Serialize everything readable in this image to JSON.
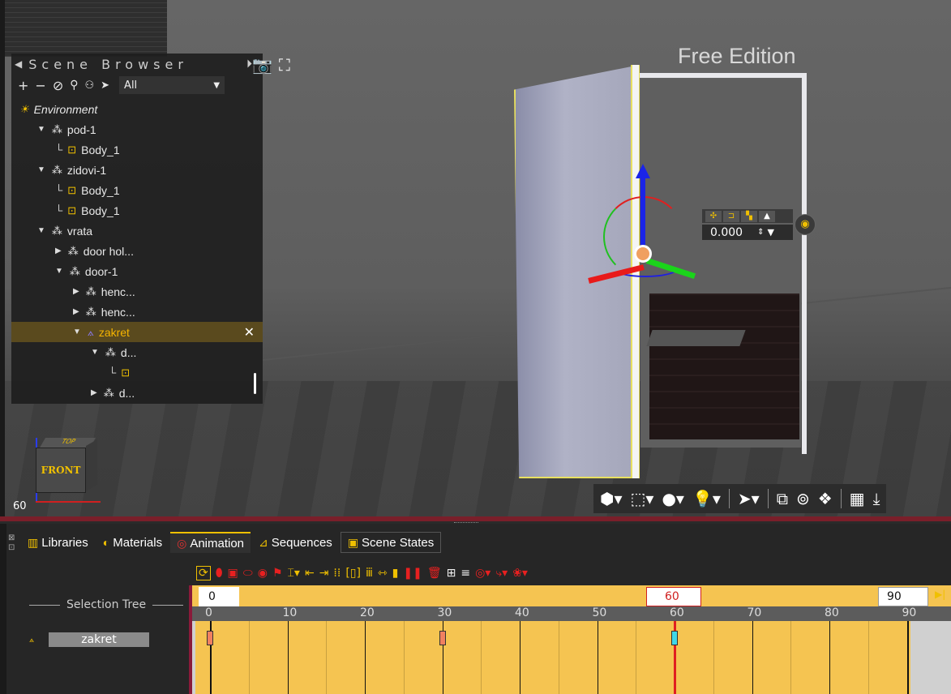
{
  "viewport": {
    "watermark": "Free Edition",
    "fps": "60",
    "viewcube_face": "FRONT",
    "viewcube_top": "TOP",
    "axis_z": "z",
    "axis_x": "x"
  },
  "scene_browser": {
    "title": "Scene Browser",
    "filter_value": "All",
    "tree": [
      {
        "label": "Environment",
        "depth": 0,
        "kind": "env"
      },
      {
        "label": "pod-1",
        "depth": 1,
        "kind": "group",
        "expanded": true
      },
      {
        "label": "Body_1",
        "depth": 2,
        "kind": "body"
      },
      {
        "label": "zidovi-1",
        "depth": 1,
        "kind": "group",
        "expanded": true
      },
      {
        "label": "Body_1",
        "depth": 2,
        "kind": "body"
      },
      {
        "label": "Body_1",
        "depth": 2,
        "kind": "body"
      },
      {
        "label": "vrata",
        "depth": 1,
        "kind": "group",
        "expanded": true
      },
      {
        "label": "door hol...",
        "depth": 2,
        "kind": "group",
        "expanded": false
      },
      {
        "label": "door-1",
        "depth": 2,
        "kind": "group",
        "expanded": true
      },
      {
        "label": "henc...",
        "depth": 3,
        "kind": "group",
        "expanded": false
      },
      {
        "label": "henc...",
        "depth": 3,
        "kind": "group",
        "expanded": false
      },
      {
        "label": "zakret",
        "depth": 3,
        "kind": "anim",
        "expanded": true,
        "selected": true
      },
      {
        "label": "d...",
        "depth": 4,
        "kind": "group",
        "expanded": true
      },
      {
        "label": "",
        "depth": 5,
        "kind": "body"
      },
      {
        "label": "d...",
        "depth": 4,
        "kind": "group",
        "expanded": false
      }
    ]
  },
  "transform_widget": {
    "value": "0.000"
  },
  "bottom_tabs": [
    {
      "label": "Libraries",
      "icon": "books-icon"
    },
    {
      "label": "Materials",
      "icon": "material-icon"
    },
    {
      "label": "Animation",
      "icon": "animation-icon",
      "active": true
    },
    {
      "label": "Sequences",
      "icon": "sequences-icon"
    },
    {
      "label": "Scene States",
      "icon": "scene-states-icon"
    }
  ],
  "animation": {
    "selection_tree_label": "Selection Tree",
    "track_name": "zakret",
    "timeline_start": "0",
    "timeline_current": "60",
    "timeline_end": "90",
    "ticks": [
      "0",
      "10",
      "20",
      "30",
      "40",
      "50",
      "60",
      "70",
      "80",
      "90"
    ],
    "keyframes": [
      {
        "frame": 0,
        "color": "#f08060"
      },
      {
        "frame": 30,
        "color": "#f08060"
      },
      {
        "frame": 60,
        "color": "#40d8e8"
      }
    ],
    "current_frame": 60,
    "range_end": 90,
    "visible_max": 99
  },
  "colors": {
    "accent": "#f0c000",
    "timeline_fill": "#f5c451",
    "playhead": "#e02020",
    "splitter": "#7a1f2a"
  }
}
